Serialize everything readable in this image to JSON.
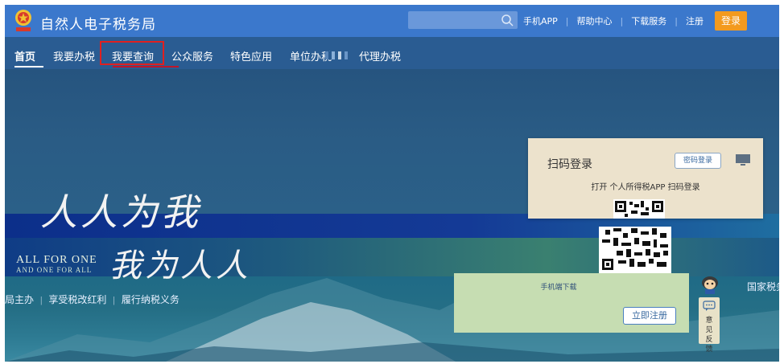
{
  "header": {
    "site_title": "自然人电子税务局",
    "links": [
      "手机APP",
      "帮助中心",
      "下载服务",
      "注册"
    ],
    "login_label": "登录"
  },
  "nav": {
    "items": [
      "首页",
      "我要办税",
      "我要查询",
      "公众服务",
      "特色应用",
      "单位办税"
    ],
    "trailing": "代理办税"
  },
  "hero": {
    "slogan_cn_1": "人人为我",
    "slogan_cn_2": "我为人人",
    "slogan_en_1": "ALL FOR ONE",
    "slogan_en_2": "AND ONE FOR ALL",
    "tagline": [
      "局主办",
      "享受税改红利",
      "履行纳税义务"
    ],
    "right_tag": "国家税务"
  },
  "login_card": {
    "title": "扫码登录",
    "password_login_label": "密码登录",
    "open_app_text": "打开 个人所得税APP 扫码登录",
    "download_text": "手机端下载",
    "register_label": "立即注册"
  },
  "feedback": {
    "label": "意见反馈"
  },
  "colors": {
    "topbar": "#3b78cc",
    "navbar": "#2a5c92",
    "login_button": "#f39a1e",
    "highlight_box": "#e02020",
    "card": "#ece2cc"
  },
  "icons": [
    "emblem-icon",
    "search-icon",
    "monitor-icon",
    "mascot-icon",
    "chat-icon"
  ]
}
